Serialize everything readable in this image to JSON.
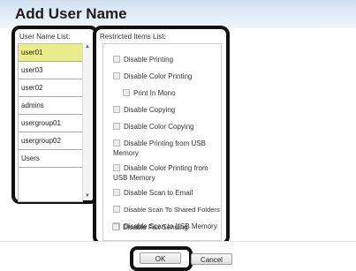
{
  "dialog": {
    "title": "Add User Name"
  },
  "user_list": {
    "label": "User Name List:",
    "items": [
      "user01",
      "user03",
      "user02",
      "admins",
      "usergroup01",
      "usergroup02",
      "Users"
    ],
    "selected": "user01"
  },
  "restrictions": {
    "label": "Restricted Items List:",
    "items": [
      {
        "label": "Disable Printing",
        "checked": false
      },
      {
        "label": "Disable Color Printing",
        "checked": false
      },
      {
        "label": "Print In Mono",
        "checked": false
      },
      {
        "label": "Disable Copying",
        "checked": false
      },
      {
        "label": "Disable Color Copying",
        "checked": false
      },
      {
        "label": "Disable Printing from USB Memory",
        "checked": false
      },
      {
        "label": "Disable Color Printing from USB Memory",
        "checked": false
      },
      {
        "label": "Disable Scan to Email",
        "checked": false
      },
      {
        "label": "Disable Scan To Shared Folders",
        "checked": false
      },
      {
        "label": "Disable Scan to USB Memory",
        "checked": false
      },
      {
        "label": "Disable Fax Sending",
        "checked": false
      }
    ]
  },
  "buttons": {
    "ok": "OK",
    "cancel": "Cancel"
  },
  "colors": {
    "selected_row": "#e8ee8a",
    "title_bar": "#cfe0f2",
    "highlight_outline": "#111111"
  }
}
